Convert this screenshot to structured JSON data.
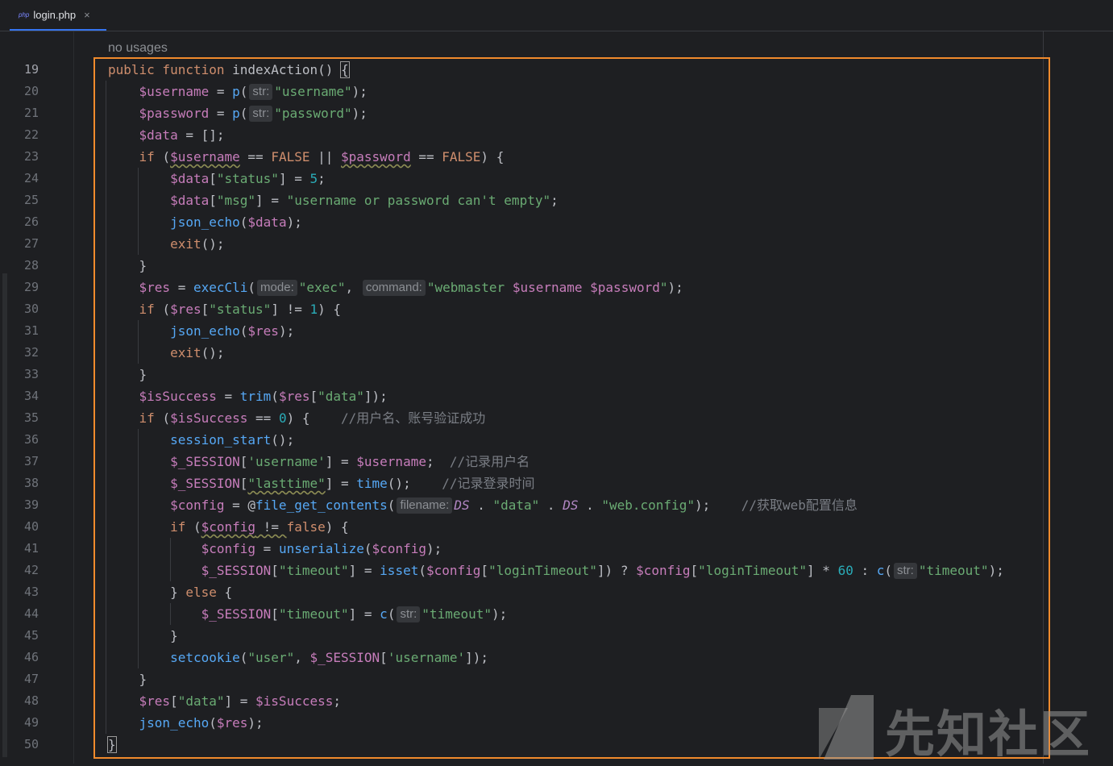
{
  "tab": {
    "lang_badge": "php",
    "filename": "login.php",
    "close_glyph": "×"
  },
  "editor": {
    "usage_hint": "no usages",
    "line_numbers": [
      "19",
      "20",
      "21",
      "22",
      "23",
      "24",
      "25",
      "26",
      "27",
      "28",
      "29",
      "30",
      "31",
      "32",
      "33",
      "34",
      "35",
      "36",
      "37",
      "38",
      "39",
      "40",
      "41",
      "42",
      "43",
      "44",
      "45",
      "46",
      "47",
      "48",
      "49",
      "50"
    ],
    "current_line": "19"
  },
  "watermark": {
    "text": "先知社区"
  },
  "colors": {
    "keyword": "#cf8e6d",
    "variable": "#c77dbb",
    "string": "#6aab73",
    "function": "#56a8f5",
    "comment": "#7a7e85",
    "number": "#2aacb8",
    "highlight_border": "#f08a2c",
    "background": "#1e1f22"
  },
  "code_lines": [
    [
      [
        "kw",
        "public function "
      ],
      [
        "id",
        "indexAction"
      ],
      [
        "id",
        "() "
      ],
      [
        "caret",
        "{"
      ]
    ],
    [
      [
        "vr",
        "    $username"
      ],
      [
        "id",
        " = "
      ],
      [
        "fn",
        "p"
      ],
      [
        "id",
        "("
      ],
      [
        "hint",
        "str:"
      ],
      [
        "st",
        "\"username\""
      ],
      [
        "id",
        ");"
      ]
    ],
    [
      [
        "vr",
        "    $password"
      ],
      [
        "id",
        " = "
      ],
      [
        "fn",
        "p"
      ],
      [
        "id",
        "("
      ],
      [
        "hint",
        "str:"
      ],
      [
        "st",
        "\"password\""
      ],
      [
        "id",
        ");"
      ]
    ],
    [
      [
        "vr",
        "    $data"
      ],
      [
        "id",
        " = [];"
      ]
    ],
    [
      [
        "kw",
        "    if "
      ],
      [
        "id",
        "("
      ],
      [
        "vrw",
        "$username"
      ],
      [
        "id",
        " == "
      ],
      [
        "kw",
        "FALSE"
      ],
      [
        "id",
        " || "
      ],
      [
        "vrw",
        "$password"
      ],
      [
        "id",
        " == "
      ],
      [
        "kw",
        "FALSE"
      ],
      [
        "id",
        ") {"
      ]
    ],
    [
      [
        "vr",
        "        $data"
      ],
      [
        "id",
        "["
      ],
      [
        "st",
        "\"status\""
      ],
      [
        "id",
        "] = "
      ],
      [
        "nm",
        "5"
      ],
      [
        "id",
        ";"
      ]
    ],
    [
      [
        "vr",
        "        $data"
      ],
      [
        "id",
        "["
      ],
      [
        "st",
        "\"msg\""
      ],
      [
        "id",
        "] = "
      ],
      [
        "st",
        "\"username or password can't empty\""
      ],
      [
        "id",
        ";"
      ]
    ],
    [
      [
        "fn",
        "        json_echo"
      ],
      [
        "id",
        "("
      ],
      [
        "vr",
        "$data"
      ],
      [
        "id",
        ");"
      ]
    ],
    [
      [
        "kw",
        "        exit"
      ],
      [
        "id",
        "();"
      ]
    ],
    [
      [
        "id",
        "    }"
      ]
    ],
    [
      [
        "vr",
        "    $res"
      ],
      [
        "id",
        " = "
      ],
      [
        "fn",
        "execCli"
      ],
      [
        "id",
        "("
      ],
      [
        "hint",
        "mode:"
      ],
      [
        "st",
        "\"exec\""
      ],
      [
        "id",
        ", "
      ],
      [
        "hint",
        "command:"
      ],
      [
        "st",
        "\"webmaster "
      ],
      [
        "vr",
        "$username"
      ],
      [
        "st",
        " "
      ],
      [
        "vr",
        "$password"
      ],
      [
        "st",
        "\""
      ],
      [
        "id",
        ");"
      ]
    ],
    [
      [
        "kw",
        "    if "
      ],
      [
        "id",
        "("
      ],
      [
        "vr",
        "$res"
      ],
      [
        "id",
        "["
      ],
      [
        "st",
        "\"status\""
      ],
      [
        "id",
        "] != "
      ],
      [
        "nm",
        "1"
      ],
      [
        "id",
        ") {"
      ]
    ],
    [
      [
        "fn",
        "        json_echo"
      ],
      [
        "id",
        "("
      ],
      [
        "vr",
        "$res"
      ],
      [
        "id",
        ");"
      ]
    ],
    [
      [
        "kw",
        "        exit"
      ],
      [
        "id",
        "();"
      ]
    ],
    [
      [
        "id",
        "    }"
      ]
    ],
    [
      [
        "vr",
        "    $isSuccess"
      ],
      [
        "id",
        " = "
      ],
      [
        "fn",
        "trim"
      ],
      [
        "id",
        "("
      ],
      [
        "vr",
        "$res"
      ],
      [
        "id",
        "["
      ],
      [
        "st",
        "\"data\""
      ],
      [
        "id",
        "]);"
      ]
    ],
    [
      [
        "kw",
        "    if "
      ],
      [
        "id",
        "("
      ],
      [
        "vr",
        "$isSuccess"
      ],
      [
        "id",
        " == "
      ],
      [
        "nm",
        "0"
      ],
      [
        "id",
        ") {    "
      ],
      [
        "cm",
        "//用户名、账号验证成功"
      ]
    ],
    [
      [
        "fn",
        "        session_start"
      ],
      [
        "id",
        "();"
      ]
    ],
    [
      [
        "vr",
        "        $_SESSION"
      ],
      [
        "id",
        "["
      ],
      [
        "st",
        "'username'"
      ],
      [
        "id",
        "] = "
      ],
      [
        "vr",
        "$username"
      ],
      [
        "id",
        ";  "
      ],
      [
        "cm",
        "//记录用户名"
      ]
    ],
    [
      [
        "vr",
        "        $_SESSION"
      ],
      [
        "id",
        "["
      ],
      [
        "stw",
        "\"lasttime\""
      ],
      [
        "id",
        "] = "
      ],
      [
        "fn",
        "time"
      ],
      [
        "id",
        "();    "
      ],
      [
        "cm",
        "//记录登录时间"
      ]
    ],
    [
      [
        "vr",
        "        $config"
      ],
      [
        "id",
        " = @"
      ],
      [
        "fn",
        "file_get_contents"
      ],
      [
        "id",
        "("
      ],
      [
        "hint",
        "filename:"
      ],
      [
        "mg",
        "DS"
      ],
      [
        "id",
        " . "
      ],
      [
        "st",
        "\"data\""
      ],
      [
        "id",
        " . "
      ],
      [
        "mg",
        "DS"
      ],
      [
        "id",
        " . "
      ],
      [
        "st",
        "\"web.config\""
      ],
      [
        "id",
        ");    "
      ],
      [
        "cm",
        "//获取web配置信息"
      ]
    ],
    [
      [
        "kw",
        "        if "
      ],
      [
        "id",
        "("
      ],
      [
        "vrw",
        "$config"
      ],
      [
        "idw",
        " != "
      ],
      [
        "kw",
        "false"
      ],
      [
        "id",
        ") {"
      ]
    ],
    [
      [
        "vr",
        "            $config"
      ],
      [
        "id",
        " = "
      ],
      [
        "fn",
        "unserialize"
      ],
      [
        "id",
        "("
      ],
      [
        "vr",
        "$config"
      ],
      [
        "id",
        ");"
      ]
    ],
    [
      [
        "vr",
        "            $_SESSION"
      ],
      [
        "id",
        "["
      ],
      [
        "st",
        "\"timeout\""
      ],
      [
        "id",
        "] = "
      ],
      [
        "fn",
        "isset"
      ],
      [
        "id",
        "("
      ],
      [
        "vr",
        "$config"
      ],
      [
        "id",
        "["
      ],
      [
        "st",
        "\"loginTimeout\""
      ],
      [
        "id",
        "]) ? "
      ],
      [
        "vr",
        "$config"
      ],
      [
        "id",
        "["
      ],
      [
        "st",
        "\"loginTimeout\""
      ],
      [
        "id",
        "] * "
      ],
      [
        "nm",
        "60"
      ],
      [
        "id",
        " : "
      ],
      [
        "fn",
        "c"
      ],
      [
        "id",
        "("
      ],
      [
        "hint",
        "str:"
      ],
      [
        "st",
        "\"timeout\""
      ],
      [
        "id",
        ");"
      ]
    ],
    [
      [
        "id",
        "        } "
      ],
      [
        "kw",
        "else"
      ],
      [
        "id",
        " {"
      ]
    ],
    [
      [
        "vr",
        "            $_SESSION"
      ],
      [
        "id",
        "["
      ],
      [
        "st",
        "\"timeout\""
      ],
      [
        "id",
        "] = "
      ],
      [
        "fn",
        "c"
      ],
      [
        "id",
        "("
      ],
      [
        "hint",
        "str:"
      ],
      [
        "st",
        "\"timeout\""
      ],
      [
        "id",
        ");"
      ]
    ],
    [
      [
        "id",
        "        }"
      ]
    ],
    [
      [
        "fn",
        "        setcookie"
      ],
      [
        "id",
        "("
      ],
      [
        "st",
        "\"user\""
      ],
      [
        "id",
        ", "
      ],
      [
        "vr",
        "$_SESSION"
      ],
      [
        "id",
        "["
      ],
      [
        "st",
        "'username'"
      ],
      [
        "id",
        "]);"
      ]
    ],
    [
      [
        "id",
        "    }"
      ]
    ],
    [
      [
        "vr",
        "    $res"
      ],
      [
        "id",
        "["
      ],
      [
        "st",
        "\"data\""
      ],
      [
        "id",
        "] = "
      ],
      [
        "vr",
        "$isSuccess"
      ],
      [
        "id",
        ";"
      ]
    ],
    [
      [
        "fn",
        "    json_echo"
      ],
      [
        "id",
        "("
      ],
      [
        "vr",
        "$res"
      ],
      [
        "id",
        ");"
      ]
    ],
    [
      [
        "caret",
        "}"
      ]
    ]
  ]
}
